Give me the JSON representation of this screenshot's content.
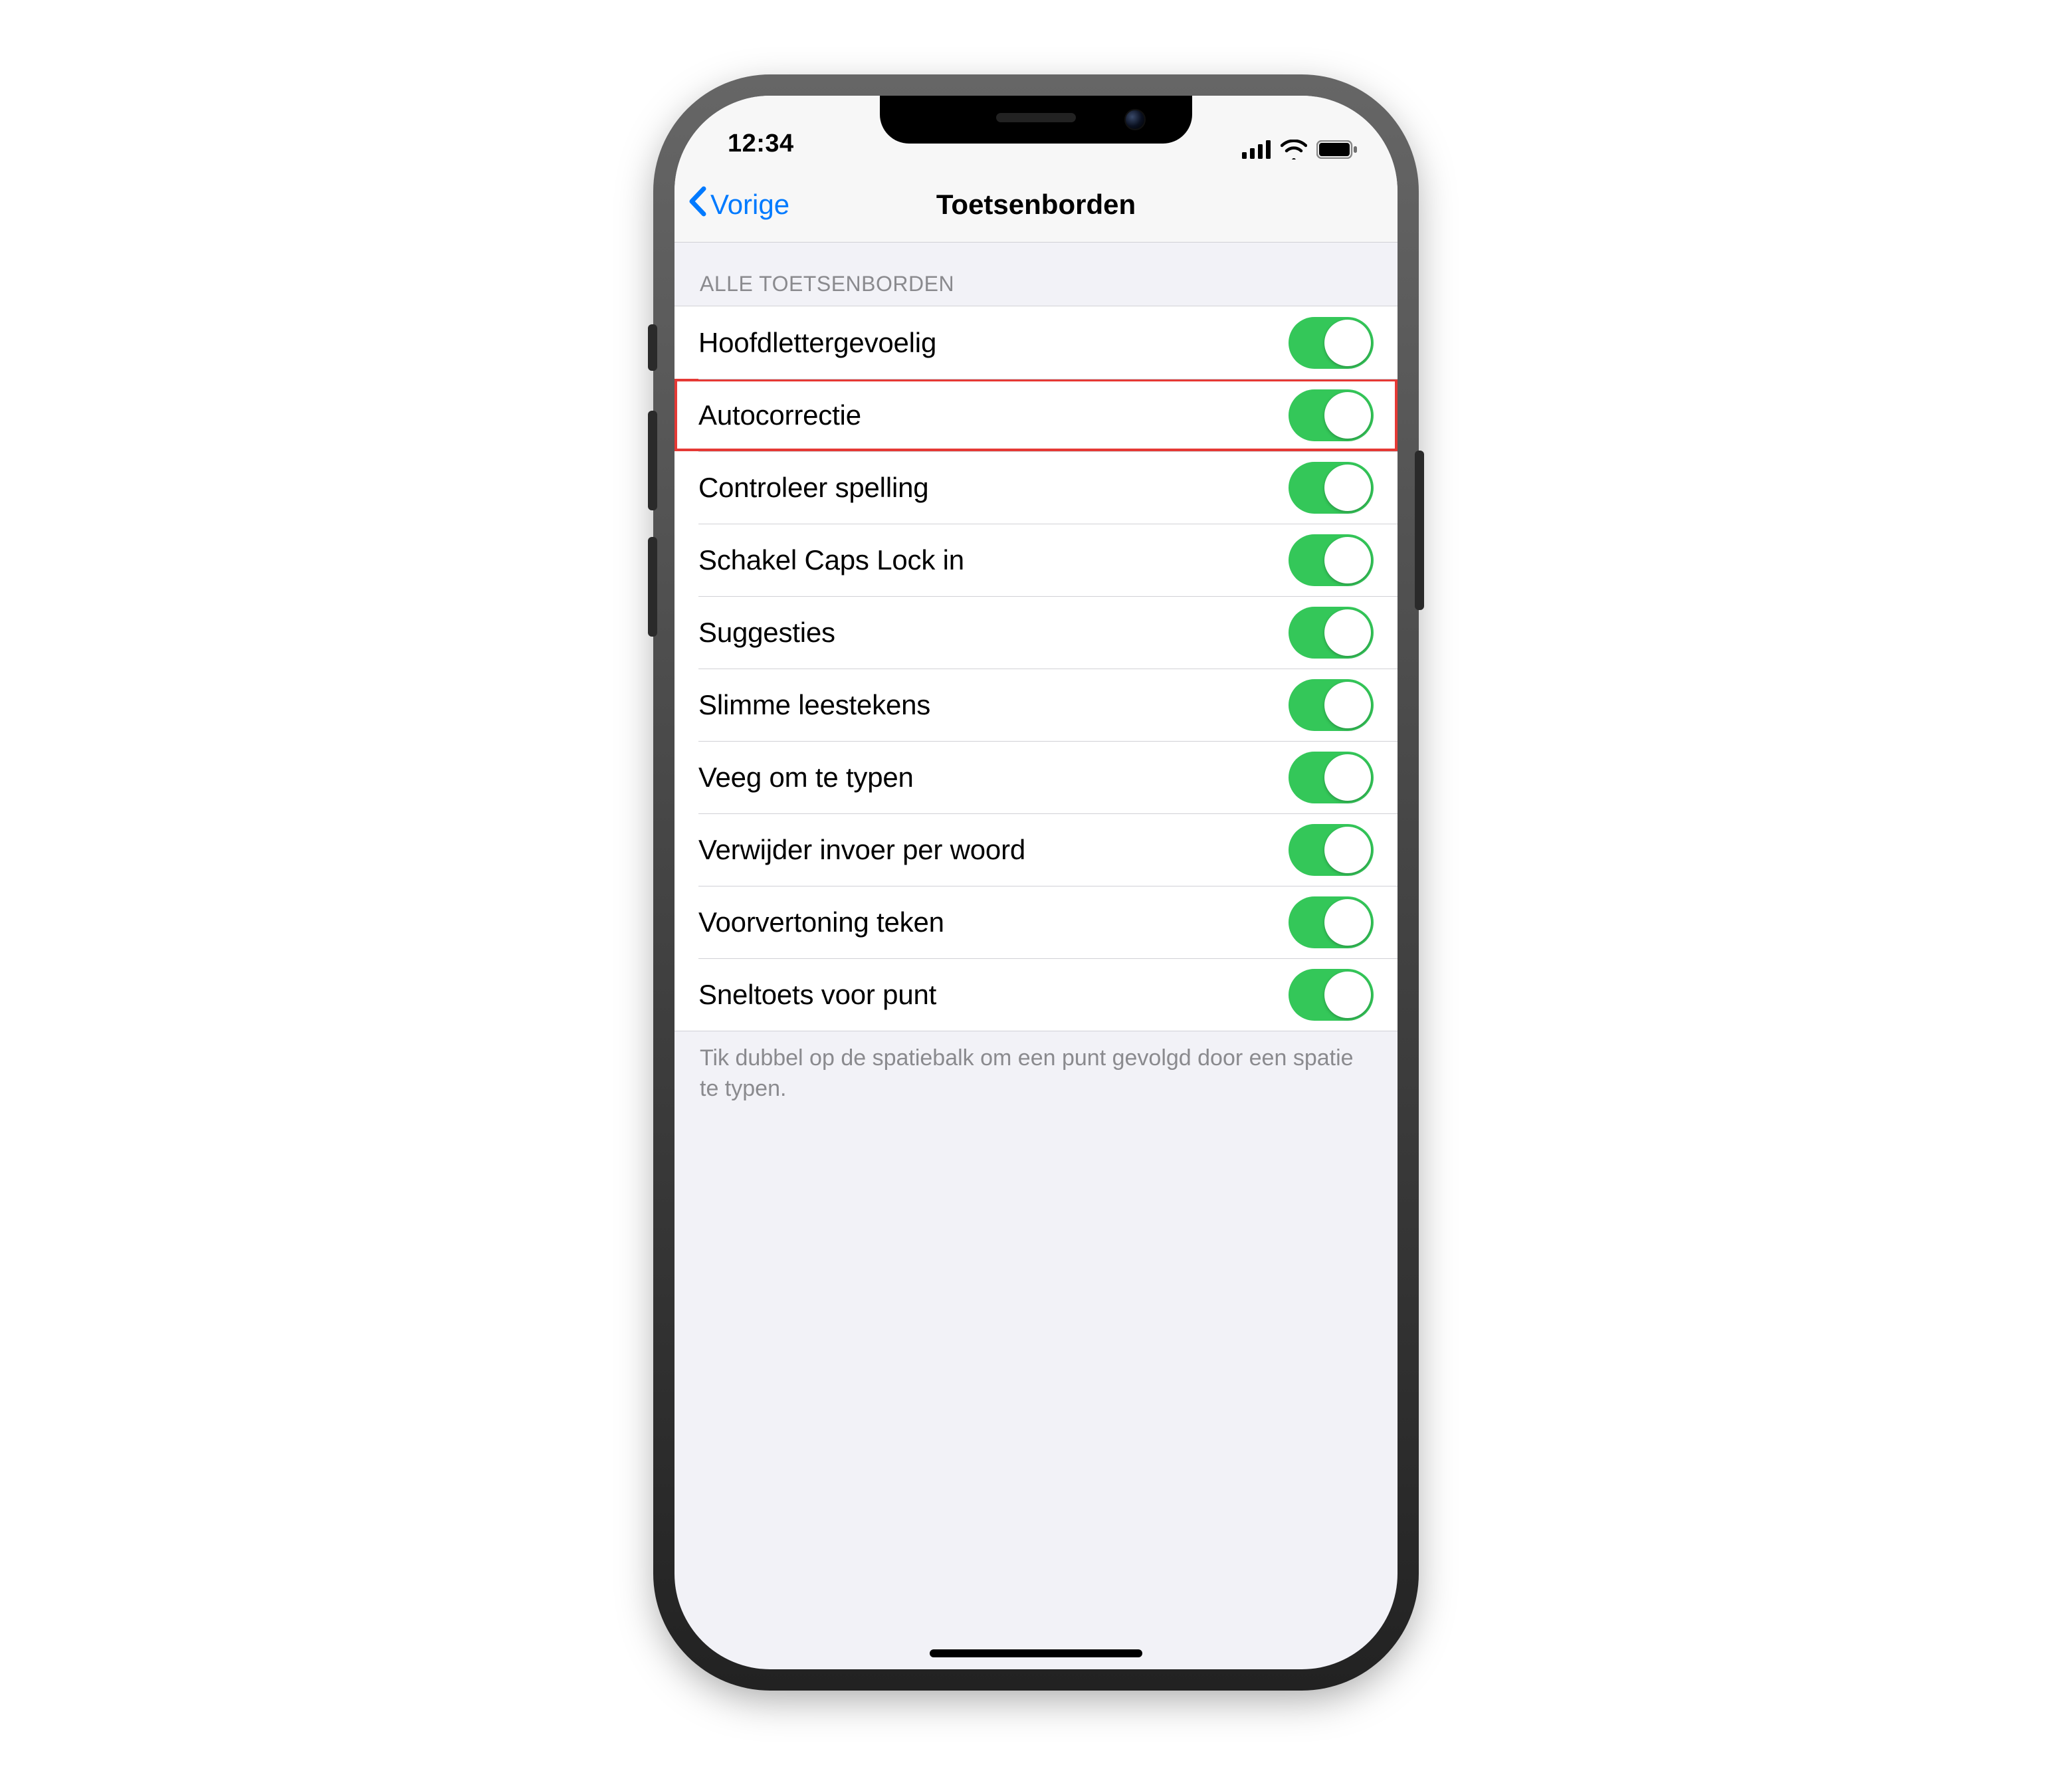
{
  "status": {
    "time": "12:34"
  },
  "nav": {
    "back_label": "Vorige",
    "title": "Toetsenborden"
  },
  "section": {
    "header": "ALLE TOETSENBORDEN",
    "footer": "Tik dubbel op de spatiebalk om een punt gevolgd door een spatie te typen."
  },
  "rows": [
    {
      "id": "auto-cap",
      "label": "Hoofdlettergevoelig",
      "on": true,
      "highlighted": false
    },
    {
      "id": "autocorrect",
      "label": "Autocorrectie",
      "on": true,
      "highlighted": true
    },
    {
      "id": "check-spelling",
      "label": "Controleer spelling",
      "on": true,
      "highlighted": false
    },
    {
      "id": "caps-lock",
      "label": "Schakel Caps Lock in",
      "on": true,
      "highlighted": false
    },
    {
      "id": "predictive",
      "label": "Suggesties",
      "on": true,
      "highlighted": false
    },
    {
      "id": "smart-punct",
      "label": "Slimme leestekens",
      "on": true,
      "highlighted": false
    },
    {
      "id": "slide-to-type",
      "label": "Veeg om te typen",
      "on": true,
      "highlighted": false
    },
    {
      "id": "delete-word",
      "label": "Verwijder invoer per woord",
      "on": true,
      "highlighted": false
    },
    {
      "id": "char-preview",
      "label": "Voorvertoning teken",
      "on": true,
      "highlighted": false
    },
    {
      "id": "period-shortcut",
      "label": "Sneltoets voor punt",
      "on": true,
      "highlighted": false
    }
  ],
  "colors": {
    "accent": "#007aff",
    "switch_on": "#34c759",
    "highlight_border": "#e53935"
  }
}
